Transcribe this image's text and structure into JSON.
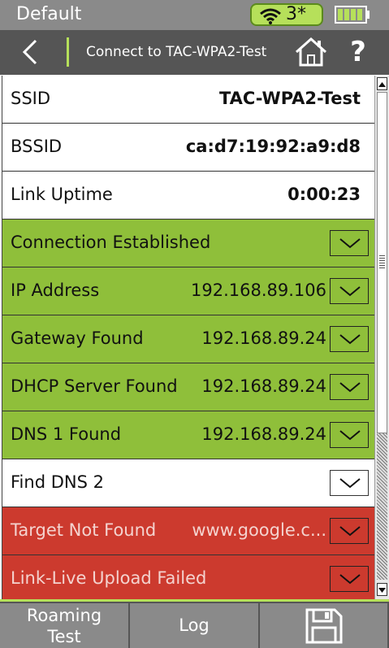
{
  "status": {
    "profile": "Default",
    "wifi_count": "3*",
    "icons": [
      "wifi-icon",
      "battery-icon"
    ]
  },
  "header": {
    "title": "Connect to TAC-WPA2-Test",
    "icons": [
      "back-icon",
      "home-icon"
    ],
    "help_label": "?"
  },
  "rows": [
    {
      "label": "SSID",
      "value": "TAC-WPA2-Test"
    },
    {
      "label": "BSSID",
      "value": "ca:d7:19:92:a9:d8"
    },
    {
      "label": "Link Uptime",
      "value": "0:00:23"
    },
    {
      "label": "Connection Established",
      "value": ""
    },
    {
      "label": "IP Address",
      "value": "192.168.89.106"
    },
    {
      "label": "Gateway Found",
      "value": "192.168.89.24"
    },
    {
      "label": "DHCP Server Found",
      "value": "192.168.89.24"
    },
    {
      "label": "DNS 1 Found",
      "value": "192.168.89.24"
    },
    {
      "label": "Find DNS 2",
      "value": ""
    },
    {
      "label": "Target Not Found",
      "value": "www.google.c..."
    },
    {
      "label": "Link-Live Upload Failed",
      "value": ""
    }
  ],
  "footer": {
    "roaming_label_1": "Roaming",
    "roaming_label_2": "Test",
    "log_label": "Log",
    "save_icon": "save-icon"
  },
  "colors": {
    "success": "#8fbf3a",
    "error": "#cc3a2e",
    "accent": "#b6e05a",
    "header": "#555555"
  }
}
